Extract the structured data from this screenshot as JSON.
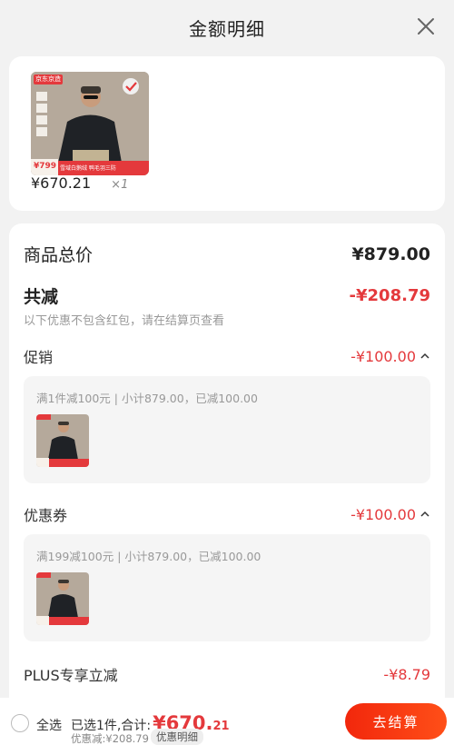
{
  "header": {
    "title": "金额明细",
    "close_icon": "close-icon"
  },
  "product": {
    "store_tag": "京东京造",
    "img_price": "¥799",
    "img_caption": "雪域白鹅绒 鸭毛羽三防",
    "price": "¥670.21",
    "qty": "×1"
  },
  "summary": {
    "total_label": "商品总价",
    "total_value": "¥879.00",
    "reduce_label": "共减",
    "reduce_value": "-¥208.79",
    "note": "以下优惠不包含红包，请在结算页查看"
  },
  "promo": {
    "label": "促销",
    "value": "-¥100.00",
    "detail": "满1件减100元 | 小计879.00，已减100.00"
  },
  "coupon": {
    "label": "优惠券",
    "value": "-¥100.00",
    "detail": "满199减100元 | 小计879.00，已减100.00"
  },
  "plus": {
    "label": "PLUS专享立减",
    "value": "-¥8.79"
  },
  "bottom": {
    "select_all": "全选",
    "selected_prefix": "已选1件,合计:",
    "total_main": "¥670.",
    "total_decimal": "21",
    "discount_line": "优惠减:¥208.79",
    "detail_tag": "优惠明细",
    "checkout_label": "去结算"
  },
  "colors": {
    "accent_red": "#e4393c",
    "checkout_gradient_start": "#f2270c",
    "checkout_gradient_end": "#ff4f18"
  }
}
